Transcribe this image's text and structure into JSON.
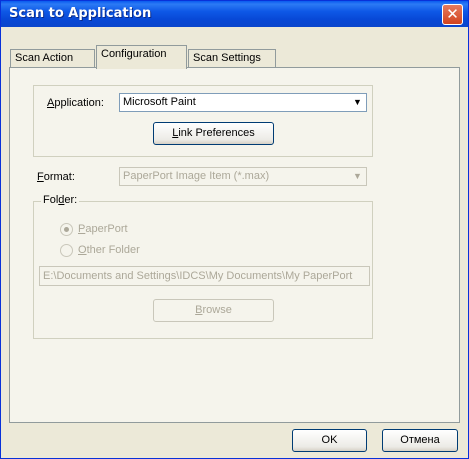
{
  "window": {
    "title": "Scan to Application",
    "close_glyph": "✕"
  },
  "tabs": [
    {
      "label": "Scan Action"
    },
    {
      "label": "Configuration"
    },
    {
      "label": "Scan Settings"
    }
  ],
  "application": {
    "label_pre": "",
    "label_mnemonic": "A",
    "label_post": "pplication:",
    "value": "Microsoft Paint",
    "link_button_mnemonic": "L",
    "link_button_rest": "ink Preferences"
  },
  "format": {
    "label_mnemonic": "F",
    "label_post": "ormat:",
    "value": "PaperPort Image Item (*.max)"
  },
  "folder": {
    "legend_pre": "Fol",
    "legend_mnemonic": "d",
    "legend_post": "er:",
    "radio_paperport_mnemonic": "P",
    "radio_paperport_rest": "aperPort",
    "radio_paperport_checked": true,
    "radio_other_mnemonic": "O",
    "radio_other_rest": "ther Folder",
    "radio_other_checked": false,
    "path": "E:\\Documents and Settings\\IDCS\\My Documents\\My PaperPort",
    "browse_mnemonic": "B",
    "browse_rest": "rowse"
  },
  "footer": {
    "ok_label": "OK",
    "cancel_label": "Отмена"
  },
  "icons": {
    "dropdown": "chevron-down-icon",
    "close": "close-icon"
  }
}
